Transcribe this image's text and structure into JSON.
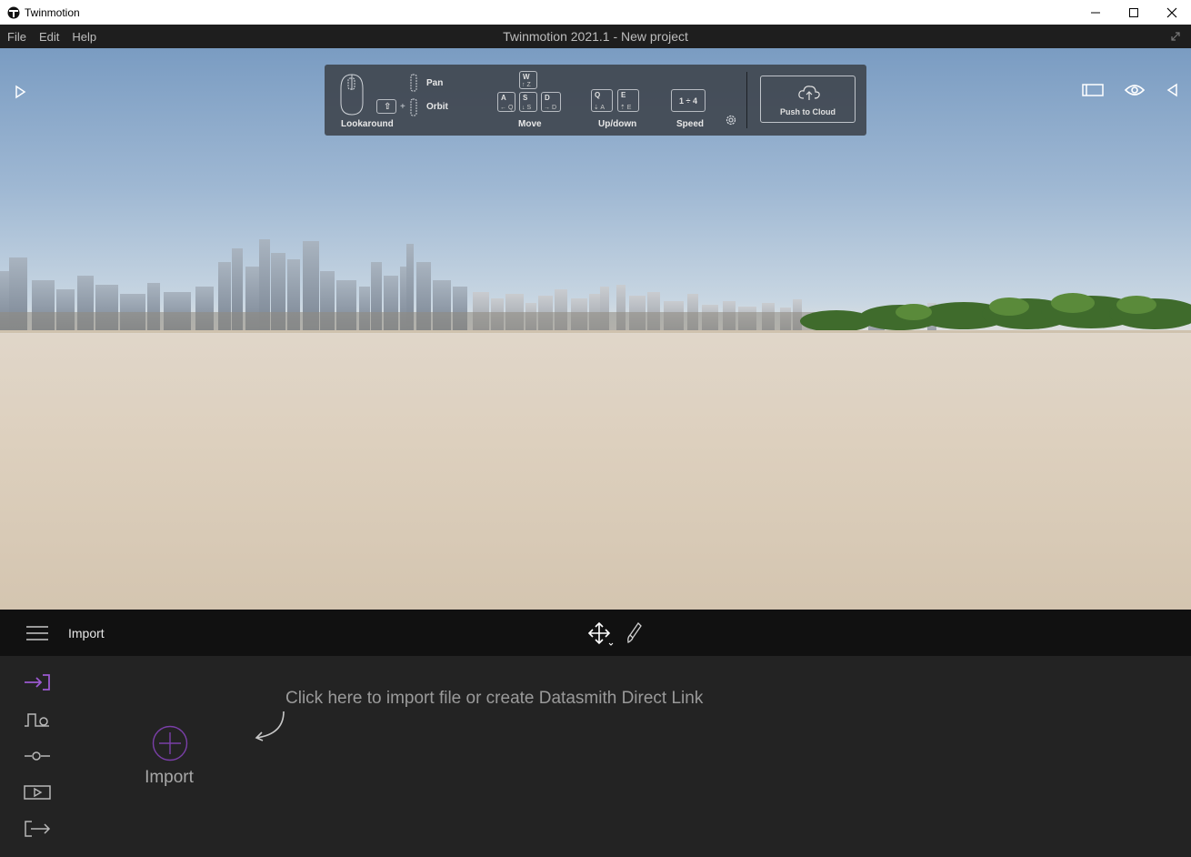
{
  "window": {
    "app_name": "Twinmotion"
  },
  "menu": {
    "items": [
      "File",
      "Edit",
      "Help"
    ],
    "title": "Twinmotion 2021.1 - New project"
  },
  "help_overlay": {
    "lookaround": "Lookaround",
    "pan": "Pan",
    "orbit": "Orbit",
    "move": "Move",
    "updown": "Up/down",
    "speed": "Speed",
    "push_to_cloud": "Push to Cloud",
    "keys": {
      "w": "W",
      "w_sub": "↑ Z",
      "a": "A",
      "a_sub": "← Q",
      "s": "S",
      "s_sub": "↓ S",
      "d": "D",
      "d_sub": "→ D",
      "q": "Q",
      "q_sub": "⇣ A",
      "e": "E",
      "e_sub": "⇡ E",
      "speed_range": "1 ÷ 4",
      "shift": "⇧",
      "plus": "+"
    }
  },
  "bottom_bar": {
    "title": "Import"
  },
  "panel": {
    "hint": "Click here to import file or create Datasmith Direct Link",
    "import_label": "Import"
  },
  "colors": {
    "accent": "#9b59d0",
    "toolbar_bg": "#111111",
    "panel_bg": "#232323"
  }
}
